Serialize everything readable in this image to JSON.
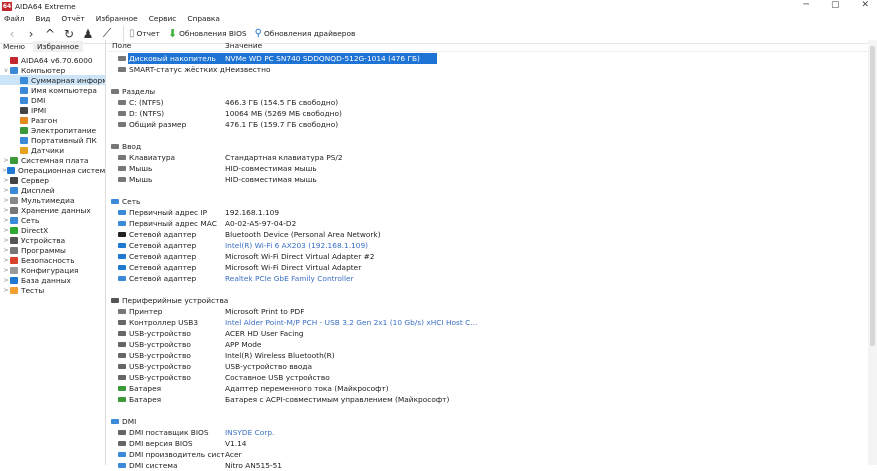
{
  "window": {
    "title": "AIDA64 Extreme",
    "logo": "64",
    "controls": [
      "─",
      "▢",
      "✕"
    ]
  },
  "menu": [
    "Файл",
    "Вид",
    "Отчёт",
    "Избранное",
    "Сервис",
    "Справка"
  ],
  "toolbar": {
    "report": "Отчет",
    "bios": "Обновления BIOS",
    "drivers": "Обновления драйверов"
  },
  "left_tabs": [
    "Меню",
    "Избранное"
  ],
  "tree": [
    {
      "label": "AIDA64 v6.70.6000",
      "level": 0,
      "exp": "",
      "color": "#c0282d"
    },
    {
      "label": "Компьютер",
      "level": 0,
      "exp": "v",
      "color": "#3b8ad9"
    },
    {
      "label": "Суммарная информация",
      "level": 2,
      "exp": "",
      "color": "#3b8ad9",
      "selected": true
    },
    {
      "label": "Имя компьютера",
      "level": 2,
      "exp": "",
      "color": "#3b8ad9"
    },
    {
      "label": "DMI",
      "level": 2,
      "exp": "",
      "color": "#3b8ad9"
    },
    {
      "label": "IPMI",
      "level": 2,
      "exp": "",
      "color": "#444"
    },
    {
      "label": "Разгон",
      "level": 2,
      "exp": "",
      "color": "#e58a1f"
    },
    {
      "label": "Электропитание",
      "level": 2,
      "exp": "",
      "color": "#3a9a3a"
    },
    {
      "label": "Портативный ПК",
      "level": 2,
      "exp": "",
      "color": "#3b8ad9"
    },
    {
      "label": "Датчики",
      "level": 2,
      "exp": "",
      "color": "#e5a21f"
    },
    {
      "label": "Системная плата",
      "level": 0,
      "exp": ">",
      "color": "#3a9a3a"
    },
    {
      "label": "Операционная система",
      "level": 0,
      "exp": ">",
      "color": "#1f78d1"
    },
    {
      "label": "Сервер",
      "level": 0,
      "exp": ">",
      "color": "#444"
    },
    {
      "label": "Дисплей",
      "level": 0,
      "exp": ">",
      "color": "#3b8ad9"
    },
    {
      "label": "Мультимедиа",
      "level": 0,
      "exp": ">",
      "color": "#888"
    },
    {
      "label": "Хранение данных",
      "level": 0,
      "exp": ">",
      "color": "#777"
    },
    {
      "label": "Сеть",
      "level": 0,
      "exp": ">",
      "color": "#3b8ad9"
    },
    {
      "label": "DirectX",
      "level": 0,
      "exp": ">",
      "color": "#2fa82f"
    },
    {
      "label": "Устройства",
      "level": 0,
      "exp": ">",
      "color": "#555"
    },
    {
      "label": "Программы",
      "level": 0,
      "exp": ">",
      "color": "#777"
    },
    {
      "label": "Безопасность",
      "level": 0,
      "exp": ">",
      "color": "#d9432b"
    },
    {
      "label": "Конфигурация",
      "level": 0,
      "exp": ">",
      "color": "#999"
    },
    {
      "label": "База данных",
      "level": 0,
      "exp": ">",
      "color": "#1f78d1"
    },
    {
      "label": "Тесты",
      "level": 0,
      "exp": ">",
      "color": "#f0a030"
    }
  ],
  "columns": {
    "field": "Поле",
    "value": "Значение"
  },
  "rows": [
    {
      "f": "Дисковый накопитель",
      "v": "NVMe WD PC SN740 SDDQNQD-512G-1014  (476 ГБ)",
      "sel": true,
      "ic": "#777"
    },
    {
      "f": "SMART-статус жёстких диск...",
      "v": "Неизвестно",
      "ic": "#777"
    },
    {
      "blank": true
    },
    {
      "f": "Разделы",
      "grp": true,
      "ic": "#777"
    },
    {
      "f": "C: (NTFS)",
      "v": "466.3 ГБ (154.5 ГБ свободно)",
      "ic": "#777"
    },
    {
      "f": "D: (NTFS)",
      "v": "10064 МБ (5269 МБ свободно)",
      "ic": "#777"
    },
    {
      "f": "Общий размер",
      "v": "476.1 ГБ (159.7 ГБ свободно)",
      "ic": "#777"
    },
    {
      "blank": true
    },
    {
      "f": "Ввод",
      "grp": true,
      "ic": "#777"
    },
    {
      "f": "Клавиатура",
      "v": "Стандартная клавиатура PS/2",
      "ic": "#777"
    },
    {
      "f": "Мышь",
      "v": "HID-совместимая мышь",
      "ic": "#777"
    },
    {
      "f": "Мышь",
      "v": "HID-совместимая мышь",
      "ic": "#777"
    },
    {
      "blank": true
    },
    {
      "f": "Сеть",
      "grp": true,
      "ic": "#3b8ad9"
    },
    {
      "f": "Первичный адрес IP",
      "v": "192.168.1.109",
      "ic": "#3b8ad9"
    },
    {
      "f": "Первичный адрес MAC",
      "v": "A0-02-A5-97-04-D2",
      "ic": "#3b8ad9"
    },
    {
      "f": "Сетевой адаптер",
      "v": "Bluetooth Device (Personal Area Network)",
      "ic": "#222"
    },
    {
      "f": "Сетевой адаптер",
      "v": "Intel(R) Wi-Fi 6 AX203  (192.168.1.109)",
      "link": true,
      "ic": "#1f78d1"
    },
    {
      "f": "Сетевой адаптер",
      "v": "Microsoft Wi-Fi Direct Virtual Adapter #2",
      "ic": "#1f78d1"
    },
    {
      "f": "Сетевой адаптер",
      "v": "Microsoft Wi-Fi Direct Virtual Adapter",
      "ic": "#1f78d1"
    },
    {
      "f": "Сетевой адаптер",
      "v": "Realtek PCIe GbE Family Controller",
      "link": true,
      "ic": "#3b8ad9"
    },
    {
      "blank": true
    },
    {
      "f": "Периферийные устройства",
      "grp": true,
      "ic": "#555"
    },
    {
      "f": "Принтер",
      "v": "Microsoft Print to PDF",
      "ic": "#777"
    },
    {
      "f": "Контроллер USB3",
      "v": "Intel Alder Point-M/P PCH - USB 3.2 Gen 2x1 (10 Gb/s) xHCI Host C...",
      "link": true,
      "ic": "#666"
    },
    {
      "f": "USB-устройство",
      "v": "ACER HD User Facing",
      "ic": "#666"
    },
    {
      "f": "USB-устройство",
      "v": "APP Mode",
      "ic": "#666"
    },
    {
      "f": "USB-устройство",
      "v": "Intel(R) Wireless Bluetooth(R)",
      "ic": "#666"
    },
    {
      "f": "USB-устройство",
      "v": "USB-устройство ввода",
      "ic": "#666"
    },
    {
      "f": "USB-устройство",
      "v": "Составное USB устройство",
      "ic": "#666"
    },
    {
      "f": "Батарея",
      "v": "Адаптер переменного тока (Майкрософт)",
      "ic": "#3a9a3a"
    },
    {
      "f": "Батарея",
      "v": "Батарея с ACPI-совместимым управлением (Майкрософт)",
      "ic": "#3a9a3a"
    },
    {
      "blank": true
    },
    {
      "f": "DMI",
      "grp": true,
      "ic": "#3b8ad9"
    },
    {
      "f": "DMI поставщик BIOS",
      "v": "INSYDE Corp.",
      "link": true,
      "ic": "#666"
    },
    {
      "f": "DMI версия BIOS",
      "v": "V1.14",
      "ic": "#666"
    },
    {
      "f": "DMI производитель системы",
      "v": "Acer",
      "ic": "#3b8ad9"
    },
    {
      "f": "DMI система",
      "v": "Nitro AN515-51",
      "ic": "#3b8ad9"
    }
  ]
}
